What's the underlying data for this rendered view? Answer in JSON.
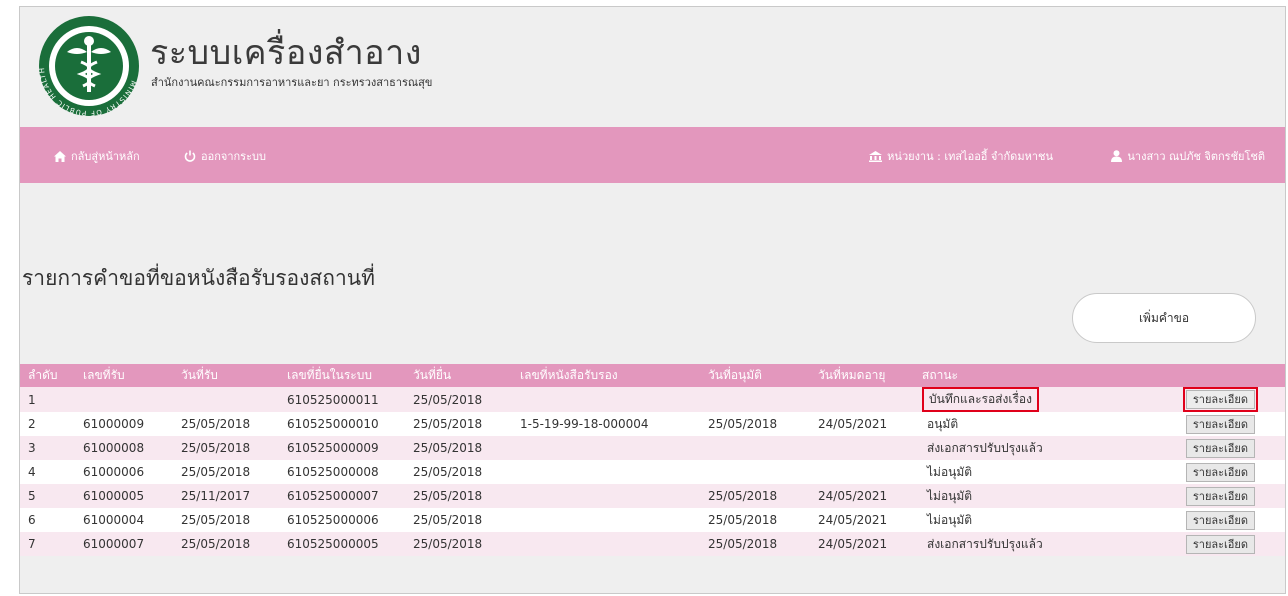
{
  "header": {
    "title": "ระบบเครื่องสำอาง",
    "subtitle": "สำนักงานคณะกรรมการอาหารและยา กระทรวงสาธารณสุข",
    "logo_text": "MINISTRY OF PUBLIC HEALTH"
  },
  "nav": {
    "home_label": "กลับสู่หน้าหลัก",
    "logout_label": "ออกจากระบบ",
    "unit_label": "หน่วยงาน : เทสไอออี้ จำกัดมหาชน",
    "user_label": "นางสาว ณปภัช จิตกรชัยโชติ",
    "home_icon": "home-icon",
    "logout_icon": "power-icon",
    "unit_icon": "building-icon",
    "user_icon": "user-icon"
  },
  "page": {
    "title": "รายการคำขอที่ขอหนังสือรับรองสถานที่",
    "add_button_label": "เพิ่มคำขอ"
  },
  "table": {
    "columns": [
      "ลำดับ",
      "เลขที่รับ",
      "วันที่รับ",
      "เลขที่ยื่นในระบบ",
      "วันที่ยื่น",
      "เลขที่หนังสือรับรอง",
      "วันที่อนุมัติ",
      "วันที่หมดอายุ",
      "สถานะ",
      ""
    ],
    "detail_label": "รายละเอียด",
    "rows": [
      {
        "no": "1",
        "receive_no": "",
        "receive_date": "",
        "system_no": "610525000011",
        "submit_date": "25/05/2018",
        "cert_no": "",
        "approve_date": "",
        "expire_date": "",
        "status": "บันทึกและรอส่งเรื่อง"
      },
      {
        "no": "2",
        "receive_no": "61000009",
        "receive_date": "25/05/2018",
        "system_no": "610525000010",
        "submit_date": "25/05/2018",
        "cert_no": "1-5-19-99-18-000004",
        "approve_date": "25/05/2018",
        "expire_date": "24/05/2021",
        "status": "อนุมัติ"
      },
      {
        "no": "3",
        "receive_no": "61000008",
        "receive_date": "25/05/2018",
        "system_no": "610525000009",
        "submit_date": "25/05/2018",
        "cert_no": "",
        "approve_date": "",
        "expire_date": "",
        "status": "ส่งเอกสารปรับปรุงแล้ว"
      },
      {
        "no": "4",
        "receive_no": "61000006",
        "receive_date": "25/05/2018",
        "system_no": "610525000008",
        "submit_date": "25/05/2018",
        "cert_no": "",
        "approve_date": "",
        "expire_date": "",
        "status": "ไม่อนุมัติ"
      },
      {
        "no": "5",
        "receive_no": "61000005",
        "receive_date": "25/11/2017",
        "system_no": "610525000007",
        "submit_date": "25/05/2018",
        "cert_no": "",
        "approve_date": "25/05/2018",
        "expire_date": "24/05/2021",
        "status": "ไม่อนุมัติ"
      },
      {
        "no": "6",
        "receive_no": "61000004",
        "receive_date": "25/05/2018",
        "system_no": "610525000006",
        "submit_date": "25/05/2018",
        "cert_no": "",
        "approve_date": "25/05/2018",
        "expire_date": "24/05/2021",
        "status": "ไม่อนุมัติ"
      },
      {
        "no": "7",
        "receive_no": "61000007",
        "receive_date": "25/05/2018",
        "system_no": "610525000005",
        "submit_date": "25/05/2018",
        "cert_no": "",
        "approve_date": "25/05/2018",
        "expire_date": "24/05/2021",
        "status": "ส่งเอกสารปรับปรุงแล้ว"
      }
    ]
  },
  "colors": {
    "accent": "#e397bd",
    "row_alt": "#f8e8f0",
    "highlight": "#e0001a",
    "logo_green": "#1a6e3a"
  }
}
